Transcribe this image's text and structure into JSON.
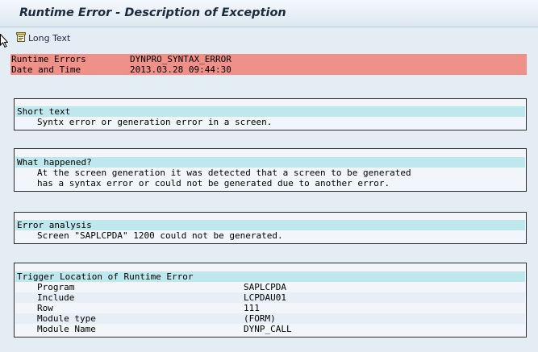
{
  "window": {
    "title": "Runtime Error - Description of Exception"
  },
  "toolbar": {
    "long_text_label": "Long Text",
    "long_text_icon": "long-text-icon"
  },
  "error_header": [
    {
      "key": "Runtime Errors",
      "value": "DYNPRO_SYNTAX_ERROR"
    },
    {
      "key": "Date and Time",
      "value": "2013.03.28 09:44:30"
    }
  ],
  "short_text": {
    "heading": "Short text",
    "lines": [
      "Syntx error or generation error in a screen."
    ]
  },
  "what_happened": {
    "heading": "What happened?",
    "lines": [
      "At the screen generation it was detected that a screen to be generated",
      "has a syntax error or could not be generated due to another error."
    ]
  },
  "error_analysis": {
    "heading": "Error analysis",
    "lines": [
      "Screen \"SAPLCPDA\" 1200 could not be generated."
    ]
  },
  "trigger_location": {
    "heading": "Trigger Location of Runtime Error",
    "rows": [
      {
        "label": "Program",
        "value": "SAPLCPDA"
      },
      {
        "label": "Include",
        "value": "LCPDAU01"
      },
      {
        "label": "Row",
        "value": "111"
      },
      {
        "label": "Module type",
        "value": "(FORM)"
      },
      {
        "label": "Module Name",
        "value": "DYNP_CALL"
      }
    ]
  },
  "colors": {
    "error_row_bg": "#f09189",
    "section_header_bg": "#bfe7ee",
    "window_bg": "#e4ecf4"
  }
}
